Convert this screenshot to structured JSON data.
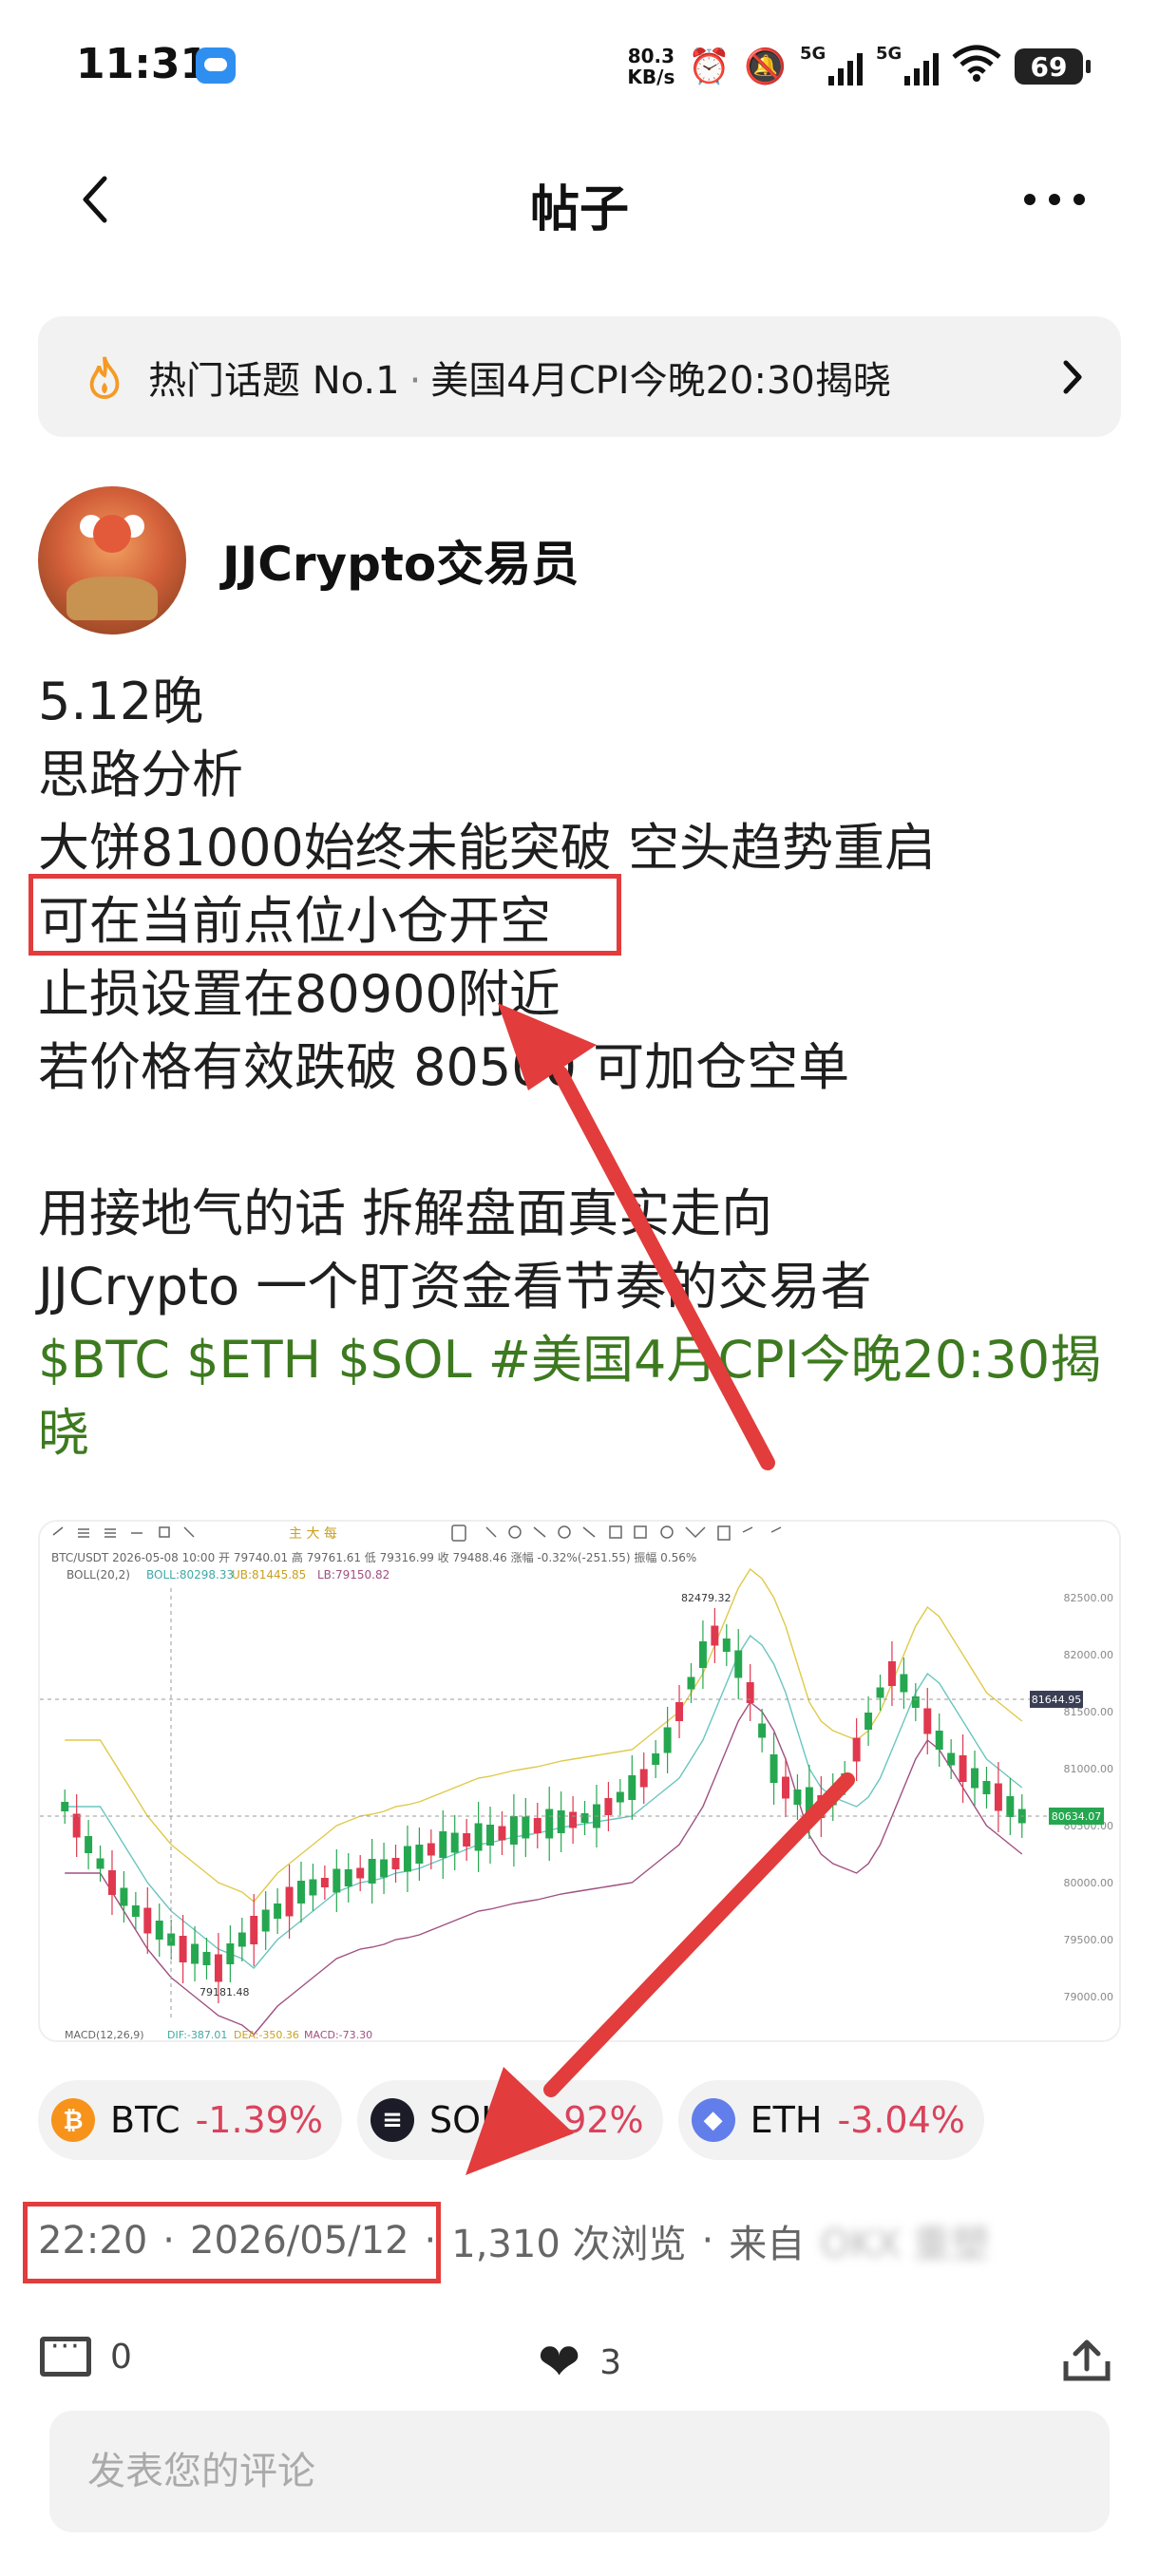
{
  "status_bar": {
    "time": "11:31",
    "net_speed_value": "80.3",
    "net_speed_unit": "KB/s",
    "signal_1_label": "5G",
    "signal_2_label": "5G",
    "battery": "69",
    "icons": [
      "cloud-icon",
      "alarm-icon",
      "mute-bell-icon",
      "wifi-icon",
      "battery-icon"
    ]
  },
  "header": {
    "title": "帖子",
    "back_icon": "chevron-left-icon",
    "more_icon": "more-dots-icon"
  },
  "trending": {
    "label": "热门话题 No.1",
    "topic": "美国4月CPI今晚20:30揭晓"
  },
  "author": {
    "name": "JJCrypto交易员"
  },
  "post": {
    "lines": [
      "5.12晚",
      "思路分析",
      "大饼81000始终未能突破 空头趋势重启",
      "可在当前点位小仓开空",
      "止损设置在80900附近",
      "若价格有效跌破 80500 可加仓空单"
    ],
    "lines2": [
      "用接地气的话 拆解盘面真实走向",
      "JJCrypto 一个盯资金看节奏的交易者"
    ],
    "tags": "$BTC $ETH $SOL #美国4月CPI今晚20:30揭晓"
  },
  "chart": {
    "header_line1": "BTC/USDT  2026-05-08 10:00  开 79740.01  高 79761.61  低 79316.99  收 79488.46  涨幅 -0.32%(-251.55)  振幅 0.56%",
    "header_line2_label": "BOLL(20,2)",
    "header_line2_boll": "BOLL:80298.33",
    "header_line2_ub": "UB:81445.85",
    "header_line2_lb": "LB:79150.82",
    "high_label": "82479.32",
    "low_label": "79181.48",
    "price_tag_1": "81644.95",
    "price_tag_2": "80634.07",
    "axis_labels": [
      "82500.00",
      "82000.00",
      "81500.00",
      "81000.00",
      "80500.00",
      "80000.00",
      "79500.00",
      "79000.00"
    ],
    "macd_label": "MACD(12,26,9)",
    "macd_dif": "DIF:-387.01",
    "macd_dea": "DEA:-350.36",
    "macd_val": "MACD:-73.30",
    "toolbar_center": "主 大 每",
    "colors": {
      "up": "#25a750",
      "down": "#e0384f",
      "boll_mid": "#6ac5c0",
      "boll_ub": "#e0c94a",
      "boll_lb": "#a05080"
    }
  },
  "chips": [
    {
      "symbol": "BTC",
      "change": "-1.39%",
      "color": "#f7931a",
      "icon": "btc-icon",
      "glyph": "₿"
    },
    {
      "symbol": "SOL",
      "change": "-2.92%",
      "color": "#1c1c28",
      "icon": "sol-icon",
      "glyph": "≡"
    },
    {
      "symbol": "ETH",
      "change": "-3.04%",
      "color": "#627eea",
      "icon": "eth-icon",
      "glyph": "◆"
    }
  ],
  "meta": {
    "time": "22:20",
    "date": "2026/05/12",
    "views": "1,310 次浏览",
    "source_label": "来自",
    "source": "OKX 重塑"
  },
  "actions": {
    "comments": "0",
    "likes": "3"
  },
  "comment_input": {
    "placeholder": "发表您的评论"
  }
}
